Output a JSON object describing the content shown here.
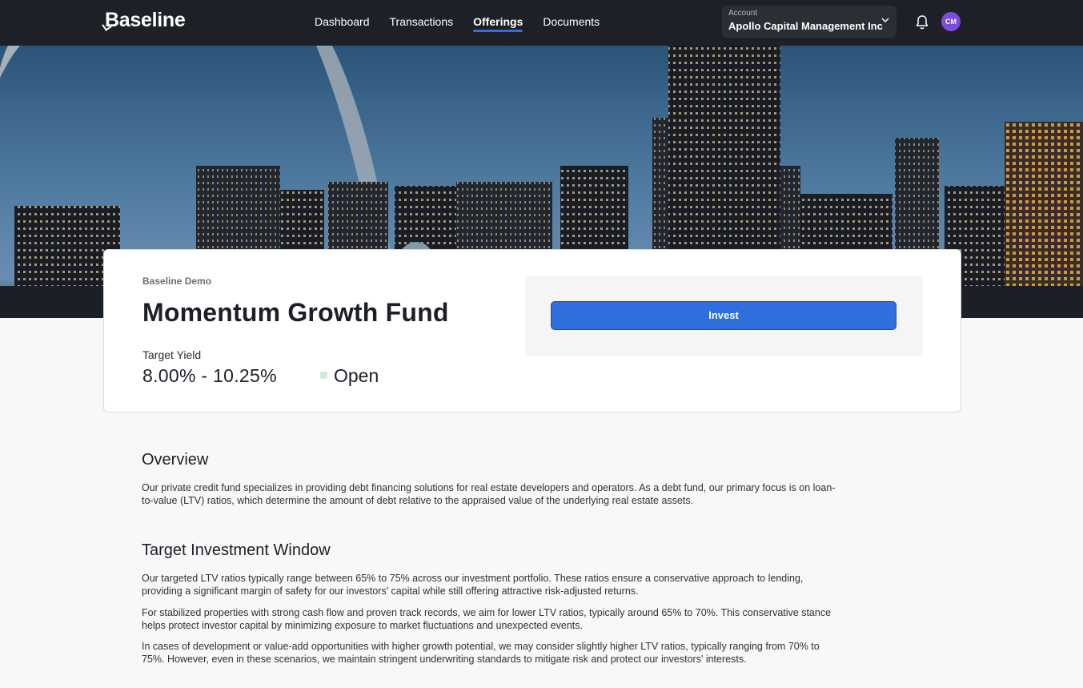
{
  "header": {
    "logo_text": "Baseline",
    "nav": [
      {
        "label": "Dashboard",
        "active": false
      },
      {
        "label": "Transactions",
        "active": false
      },
      {
        "label": "Offerings",
        "active": true
      },
      {
        "label": "Documents",
        "active": false
      }
    ],
    "account": {
      "label": "Account",
      "name": "Apollo Capital Management Inc"
    },
    "avatar_initials": "CM",
    "icons": [
      "bell-icon",
      "chevron-down-icon"
    ]
  },
  "offering": {
    "sponsor": "Baseline Demo",
    "title": "Momentum Growth Fund",
    "target_yield_label": "Target Yield",
    "target_yield_value": "8.00% - 10.25%",
    "status": "Open",
    "invest_label": "Invest"
  },
  "overview": {
    "heading": "Overview",
    "line1": "Our private credit fund specializes in providing debt financing solutions for real estate developers and operators. As a debt fund, our primary focus is on loan-",
    "line2": "to-value (LTV) ratios, which determine the amount of debt relative to the appraised value of the underlying real estate assets."
  },
  "target_window": {
    "heading": "Target Investment Window",
    "p1_line1": "Our targeted LTV ratios typically range between 65% to 75% across our investment portfolio. These ratios ensure a conservative approach to lending,",
    "p1_line2": "providing a significant margin of safety for our investors' capital while still offering attractive risk-adjusted returns.",
    "p2_line1": "For stabilized properties with strong cash flow and proven track records, we aim for lower LTV ratios, typically around 65% to 70%. This conservative stance",
    "p2_line2": "helps protect investor capital by minimizing exposure to market fluctuations and unexpected events.",
    "p3_line1": "In cases of development or value-add opportunities with higher growth potential, we may consider slightly higher LTV ratios, typically ranging from 70% to",
    "p3_line2": "75%. However, even in these scenarios, we maintain stringent underwriting standards to mitigate risk and protect our investors' interests."
  },
  "colors": {
    "nav_bg": "#1d2127",
    "accent": "#2f6fdd",
    "status_open": "#cdebd6",
    "avatar": "#7c4dd8"
  }
}
